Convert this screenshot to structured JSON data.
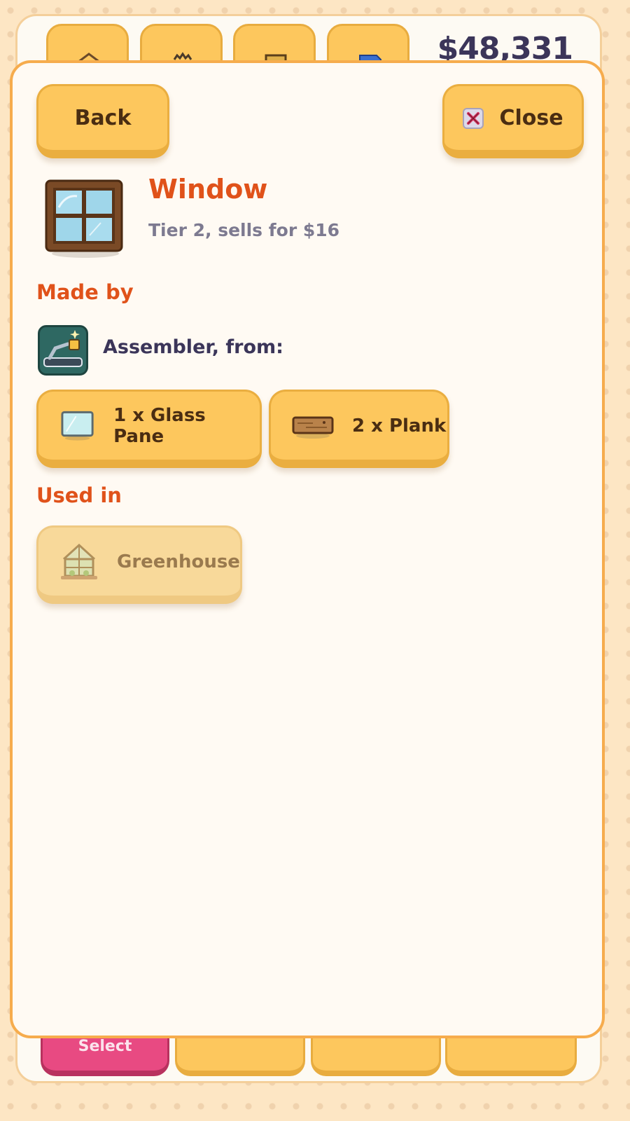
{
  "header": {
    "money": "$48,331",
    "tabs": [
      "home-tab",
      "factory-tab",
      "storage-tab",
      "blueprint-tab"
    ]
  },
  "bottom_bar": {
    "select_label": "Select"
  },
  "modal": {
    "back_label": "Back",
    "close_label": "Close",
    "item": {
      "name": "Window",
      "subtitle": "Tier 2, sells for $16"
    },
    "made_by_heading": "Made by",
    "machine_label": "Assembler, from:",
    "ingredients": [
      {
        "label": "1 x Glass Pane",
        "icon": "glass-pane-icon"
      },
      {
        "label": "2 x Plank",
        "icon": "plank-icon"
      }
    ],
    "used_in_heading": "Used in",
    "used_in": [
      {
        "label": "Greenhouse",
        "icon": "greenhouse-icon",
        "enabled": false
      }
    ]
  },
  "colors": {
    "accent_orange": "#e0521a",
    "button_yellow": "#fdc75d",
    "select_pink": "#e84a82",
    "text_dark": "#3b3559"
  }
}
